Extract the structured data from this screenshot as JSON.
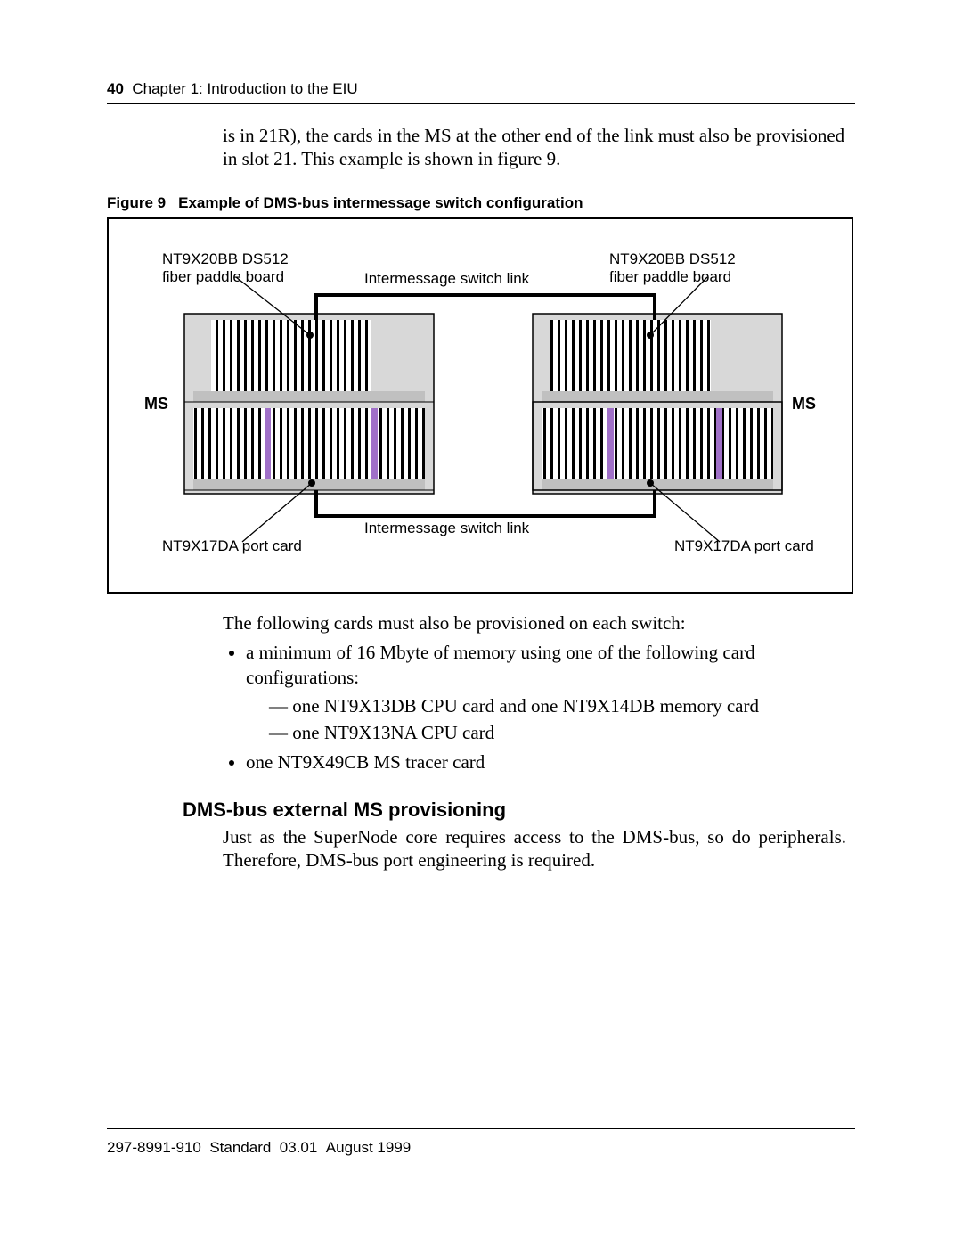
{
  "header": {
    "page_number": "40",
    "chapter": "Chapter 1: Introduction to the EIU"
  },
  "para1": "is in 21R), the cards in the MS at the other end of the link must also be provisioned in slot 21. This example is shown in figure 9.",
  "figure": {
    "label": "Figure 9",
    "title": "Example of DMS-bus intermessage switch configuration",
    "labels": {
      "fiber_left_line1": "NT9X20BB DS512",
      "fiber_left_line2": "fiber paddle board",
      "fiber_right_line1": "NT9X20BB DS512",
      "fiber_right_line2": "fiber paddle board",
      "ims_link_top": "Intermessage switch link",
      "ims_link_bottom": "Intermessage switch link",
      "port_left": "NT9X17DA port card",
      "port_right": "NT9X17DA port card",
      "ms_left": "MS",
      "ms_right": "MS"
    }
  },
  "para2": "The following cards must also be provisioned on each switch:",
  "bullets": {
    "b1": "a minimum of 16 Mbyte of memory using one of the following card configurations:",
    "d1": "one NT9X13DB CPU card and one NT9X14DB memory card",
    "d2": "one NT9X13NA CPU card",
    "b2": "one NT9X49CB MS tracer card"
  },
  "heading2": "DMS-bus external MS provisioning",
  "para3": "Just as the SuperNode core requires access to the DMS-bus, so do peripherals. Therefore, DMS-bus port engineering is required.",
  "footer": {
    "docnum": "297-8991-910",
    "status": "Standard",
    "version": "03.01",
    "date": "August 1999"
  }
}
